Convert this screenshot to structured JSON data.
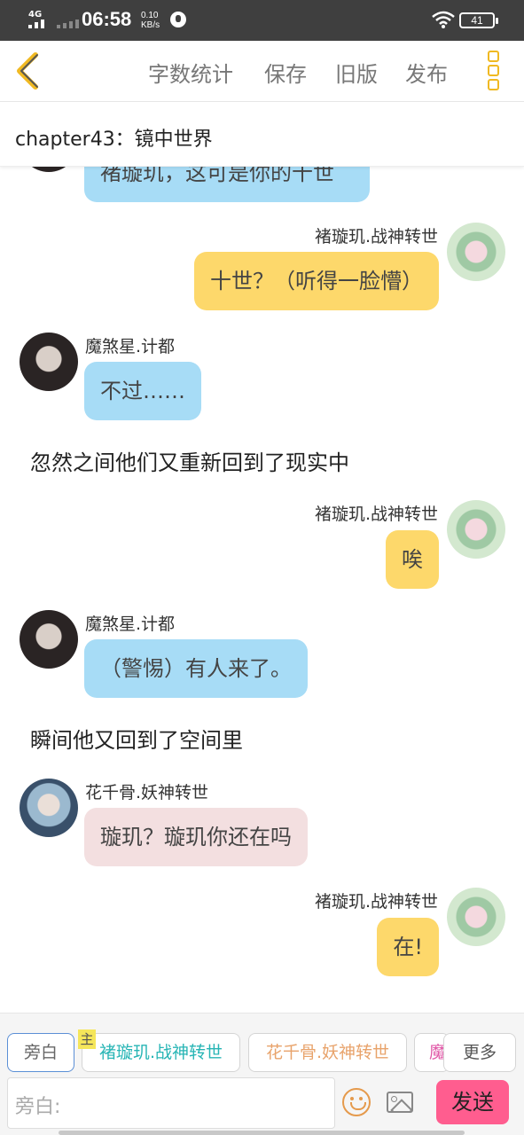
{
  "status_bar": {
    "network": "4G",
    "time": "06:58",
    "speed_value": "0.10",
    "speed_unit": "KB/s",
    "battery": "41"
  },
  "toolbar": {
    "back_icon": "chevron-left-icon",
    "word_count": "字数统计",
    "save": "保存",
    "old_version": "旧版",
    "publish": "发布",
    "more_icon": "more-vertical-icon",
    "accent_color": "#f0b922"
  },
  "chapter": {
    "title": "chapter43：镜中世界"
  },
  "messages": {
    "m0": {
      "text": "褚璇玑，这可是你的十世"
    },
    "m1": {
      "name": "褚璇玑.战神转世",
      "text": "十世？（听得一脸懵）"
    },
    "m2": {
      "name": "魔煞星.计都",
      "text": "不过……"
    },
    "m3": {
      "text": "忽然之间他们又重新回到了现实中"
    },
    "m4": {
      "name": "褚璇玑.战神转世",
      "text": "唉"
    },
    "m5": {
      "name": "魔煞星.计都",
      "text": "（警惕）有人来了。"
    },
    "m6": {
      "text": "瞬间他又回到了空间里"
    },
    "m7": {
      "name": "花千骨.妖神转世",
      "text": "璇玑？璇玑你还在吗"
    },
    "m8": {
      "name": "褚璇玑.战神转世",
      "text": "在!"
    }
  },
  "roles": {
    "narration": "旁白",
    "main_tag": "主",
    "role1": "褚璇玑.战神转世",
    "role2": "花千骨.妖神转世",
    "role3": "魔",
    "more": "更多"
  },
  "composer": {
    "placeholder": "旁白:",
    "emoji_icon": "emoji-icon",
    "image_icon": "image-icon",
    "send": "发送",
    "send_color": "#ff5d8f"
  },
  "colors": {
    "bubble_blue": "#a7dcf6",
    "bubble_yellow": "#fdd86b",
    "bubble_pink": "#f3dfe0"
  }
}
